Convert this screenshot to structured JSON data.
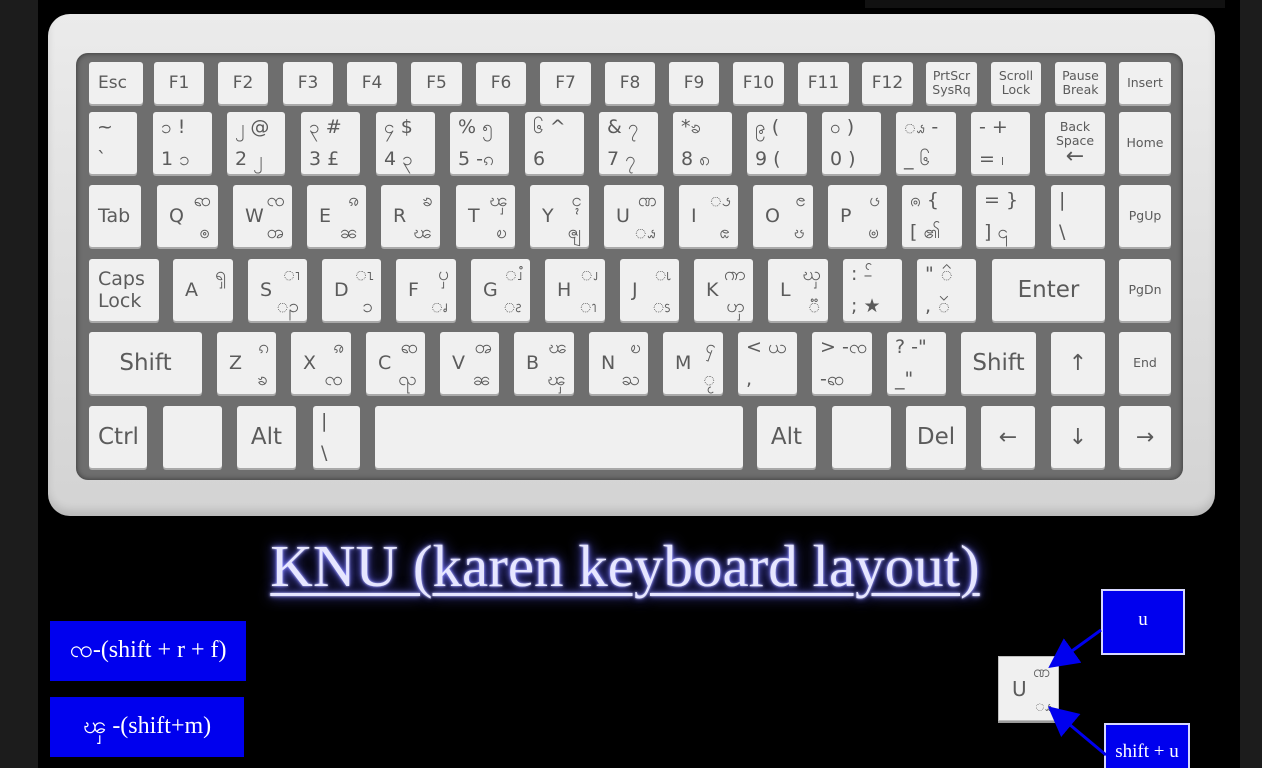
{
  "title": "KNU (karen keyboard layout)",
  "hints": [
    {
      "text": "ၸ-(shift + r + f)"
    },
    {
      "text": "ၾ -(shift+m)"
    }
  ],
  "legend": {
    "top": "u",
    "bottom": "shift + u",
    "sample": {
      "c1": "U",
      "c2": "ဏ",
      "c3": "ၗ"
    }
  },
  "keys": [
    {
      "id": "esc",
      "label": "Esc"
    },
    {
      "id": "f1",
      "label": "F1"
    },
    {
      "id": "f2",
      "label": "F2"
    },
    {
      "id": "f3",
      "label": "F3"
    },
    {
      "id": "f4",
      "label": "F4"
    },
    {
      "id": "f5",
      "label": "F5"
    },
    {
      "id": "f6",
      "label": "F6"
    },
    {
      "id": "f7",
      "label": "F7"
    },
    {
      "id": "f8",
      "label": "F8"
    },
    {
      "id": "f9",
      "label": "F9"
    },
    {
      "id": "f10",
      "label": "F10"
    },
    {
      "id": "f11",
      "label": "F11"
    },
    {
      "id": "f12",
      "label": "F12"
    },
    {
      "id": "prtscr",
      "label": "PrtScr SysRq"
    },
    {
      "id": "scroll",
      "label": "Scroll Lock"
    },
    {
      "id": "pause",
      "label": "Pause Break"
    },
    {
      "id": "insert",
      "label": "Insert"
    },
    {
      "id": "grave",
      "c1": "~",
      "c2": "`"
    },
    {
      "id": "d1",
      "c1": "ၥ !",
      "c2": "1 ၥ"
    },
    {
      "id": "d2",
      "c1": "၂ @",
      "c2": "2 ၂"
    },
    {
      "id": "d3",
      "c1": "၃ #",
      "c2": "3 £"
    },
    {
      "id": "d4",
      "c1": "၄ $",
      "c2": "4 ၃"
    },
    {
      "id": "d5",
      "c1": "% ၅",
      "c2": "5 -ၵ"
    },
    {
      "id": "d6",
      "c1": "၆ ^",
      "c2": "6"
    },
    {
      "id": "d7",
      "c1": "& ၇",
      "c2": "7 ၇"
    },
    {
      "id": "d8",
      "c1": "*ၶ",
      "c2": "8 ၈"
    },
    {
      "id": "d9",
      "c1": "၉ (",
      "c2": "9 ("
    },
    {
      "id": "d0",
      "c1": "၀ )",
      "c2": "0 )"
    },
    {
      "id": "minus",
      "c1": "ၗ -",
      "c2": "_ ၆"
    },
    {
      "id": "equal",
      "c1": "- +",
      "c2": "= ၊"
    },
    {
      "id": "backspace",
      "label": "Back Space",
      "arrow": "←"
    },
    {
      "id": "home",
      "label": "Home"
    },
    {
      "id": "tab",
      "label": "Tab"
    },
    {
      "id": "q",
      "c1": "Q",
      "c2": "ၹ",
      "c3": "ၜ"
    },
    {
      "id": "w",
      "c1": "W",
      "c2": "ၸ",
      "c3": "ၻ"
    },
    {
      "id": "e",
      "c1": "E",
      "c2": "ၷ",
      "c3": "ၼ"
    },
    {
      "id": "r",
      "c1": "R",
      "c2": "ၶ",
      "c3": "ၽ"
    },
    {
      "id": "t",
      "c1": "T",
      "c2": "ၾ",
      "c3": "ၿ"
    },
    {
      "id": "y",
      "c1": "Y",
      "c2": "ၚ",
      "c3": "ၛ"
    },
    {
      "id": "u",
      "c1": "U",
      "c2": "ဏ",
      "c3": "ၗ"
    },
    {
      "id": "i",
      "c1": "I",
      "c2": "ၖ",
      "c3": "ၕ"
    },
    {
      "id": "o",
      "c1": "O",
      "c2": "ၔ",
      "c3": "ၓ"
    },
    {
      "id": "p",
      "c1": "P",
      "c2": "ၒ",
      "c3": "ၑ"
    },
    {
      "id": "lbracket",
      "c1": "ၐ {",
      "c2": "[ ၏"
    },
    {
      "id": "rbracket",
      "c1": "= }",
      "c2": "] ၎"
    },
    {
      "id": "backslash",
      "c1": "|",
      "c2": "\\"
    },
    {
      "id": "pgup",
      "label": "PgUp"
    },
    {
      "id": "caps",
      "label": "Caps Lock"
    },
    {
      "id": "a",
      "c1": "A",
      "c2": "ၡ"
    },
    {
      "id": "s",
      "c1": "S",
      "c2": "ၢ",
      "c3": "ၣ"
    },
    {
      "id": "d",
      "c1": "D",
      "c2": "ၤ",
      "c3": "ၥ"
    },
    {
      "id": "f",
      "c1": "F",
      "c2": "ၦ",
      "c3": "ၧ"
    },
    {
      "id": "g",
      "c1": "G",
      "c2": "ၨ",
      "c3": "ၩ"
    },
    {
      "id": "h",
      "c1": "H",
      "c2": "ၪ",
      "c3": "ၫ"
    },
    {
      "id": "j",
      "c1": "J",
      "c2": "ၬ",
      "c3": "ၭ"
    },
    {
      "id": "k",
      "c1": "K",
      "c2": "ၮ",
      "c3": "ၯ"
    },
    {
      "id": "l",
      "c1": "L",
      "c2": "ၰ",
      "c3": "ၱ"
    },
    {
      "id": "semicolon",
      "c1": ": -ၲ",
      "c2": "; ★"
    },
    {
      "id": "quote",
      "c1": "\" ၳ",
      "c2": ", ၴ"
    },
    {
      "id": "enter",
      "label": "Enter"
    },
    {
      "id": "pgdn",
      "label": "PgDn"
    },
    {
      "id": "lshift",
      "label": "Shift"
    },
    {
      "id": "z",
      "c1": "Z",
      "c2": "ၵ",
      "c3": "ၶ"
    },
    {
      "id": "x",
      "c1": "X",
      "c2": "ၷ",
      "c3": "ၸ"
    },
    {
      "id": "c",
      "c1": "C",
      "c2": "ၹ",
      "c3": "ၺ"
    },
    {
      "id": "v",
      "c1": "V",
      "c2": "ၻ",
      "c3": "ၼ"
    },
    {
      "id": "b",
      "c1": "B",
      "c2": "ၽ",
      "c3": "ၾ"
    },
    {
      "id": "n",
      "c1": "N",
      "c2": "ၿ",
      "c3": "ႀ"
    },
    {
      "id": "m",
      "c1": "M",
      "c2": "ႁ",
      "c3": "ႂ"
    },
    {
      "id": "comma",
      "c1": "< ယ",
      "c2": ","
    },
    {
      "id": "period",
      "c1": "> -ၸ",
      "c2": "-ၹ"
    },
    {
      "id": "slash",
      "c1": "? -\"",
      "c2": "_\""
    },
    {
      "id": "rshift",
      "label": "Shift"
    },
    {
      "id": "up",
      "arrow": "↑"
    },
    {
      "id": "end",
      "label": "End"
    },
    {
      "id": "ctrl",
      "label": "Ctrl"
    },
    {
      "id": "blank1",
      "label": ""
    },
    {
      "id": "lalt",
      "label": "Alt"
    },
    {
      "id": "bar",
      "c1": "|",
      "c2": "\\"
    },
    {
      "id": "space",
      "label": ""
    },
    {
      "id": "ralt",
      "label": "Alt"
    },
    {
      "id": "blank2",
      "label": ""
    },
    {
      "id": "del",
      "label": "Del"
    },
    {
      "id": "left",
      "arrow": "←"
    },
    {
      "id": "down",
      "arrow": "↓"
    },
    {
      "id": "right",
      "arrow": "→"
    }
  ]
}
